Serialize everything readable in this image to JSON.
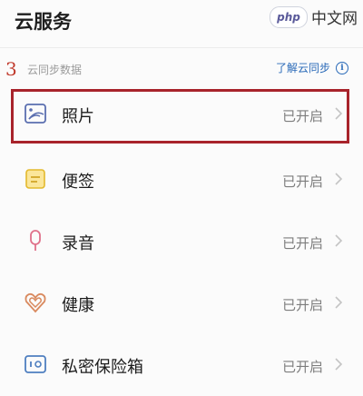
{
  "header": {
    "title": "云服务",
    "watermark_logo": "php",
    "watermark_text": "中文网"
  },
  "annotation": {
    "step_number": "3"
  },
  "section": {
    "label": "云同步数据",
    "learn_more": "了解云同步"
  },
  "items": [
    {
      "label": "照片",
      "status": "已开启",
      "icon": "photo-icon"
    },
    {
      "label": "便签",
      "status": "已开启",
      "icon": "note-icon"
    },
    {
      "label": "录音",
      "status": "已开启",
      "icon": "microphone-icon"
    },
    {
      "label": "健康",
      "status": "已开启",
      "icon": "health-heart-icon"
    },
    {
      "label": "私密保险箱",
      "status": "已开启",
      "icon": "safe-box-icon"
    }
  ],
  "colors": {
    "highlight": "#a8232b",
    "link": "#2a6ab8",
    "step": "#c0392b"
  }
}
